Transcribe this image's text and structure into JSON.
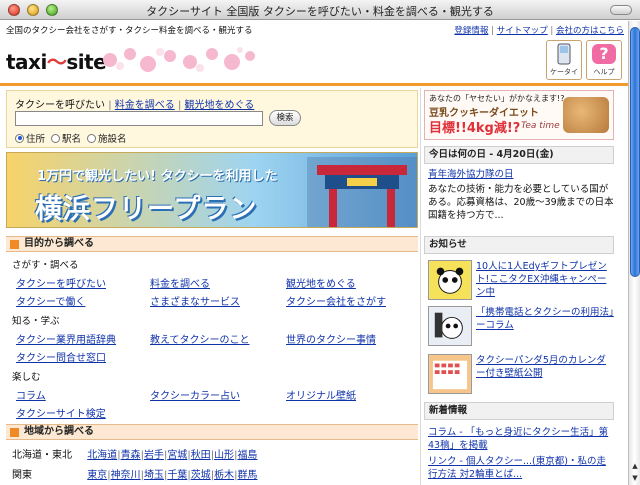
{
  "window": {
    "title": "タクシーサイト 全国版 タクシーを呼びたい・料金を調べる・観光する"
  },
  "topstrip": {
    "tagline": "全国のタクシー会社をさがす・タクシー料金を調べる・観光する",
    "links": [
      "登録情報",
      "サイトマップ",
      "会社の方はこちら"
    ]
  },
  "header": {
    "logo_text": "taxi",
    "logo_wave": "〜",
    "logo_text2": "site",
    "phone_label": "ケータイ",
    "help_label": "ヘルプ",
    "help_glyph": "?"
  },
  "search": {
    "tab_current": "タクシーを呼びたい",
    "tab_fare": "料金を調べる",
    "tab_sightseeing": "観光地をめぐる",
    "input_value": "",
    "button": "検索",
    "radios": [
      "住所",
      "駅名",
      "施設名"
    ],
    "selected": 0
  },
  "banner": {
    "line1": "1万円で観光したい! タクシーを利用した",
    "line2": "横浜フリープラン"
  },
  "purpose": {
    "heading": "目的から調べる",
    "groups": [
      {
        "label": "さがす・調べる",
        "rows": [
          [
            "タクシーを呼びたい",
            "料金を調べる",
            "観光地をめぐる"
          ],
          [
            "タクシーで働く",
            "さまざまなサービス",
            "タクシー会社をさがす"
          ]
        ]
      },
      {
        "label": "知る・学ぶ",
        "rows": [
          [
            "タクシー業界用語辞典",
            "教えてタクシーのこと",
            "世界のタクシー事情"
          ],
          [
            "タクシー問合せ窓口",
            "",
            ""
          ]
        ]
      },
      {
        "label": "楽しむ",
        "rows": [
          [
            "コラム",
            "タクシーカラー占い",
            "オリジナル壁紙"
          ],
          [
            "タクシーサイト検定",
            "",
            ""
          ]
        ]
      }
    ]
  },
  "region": {
    "heading": "地域から調べる",
    "rows": [
      {
        "name": "北海道・東北",
        "prefs": [
          "北海道",
          "青森",
          "岩手",
          "宮城",
          "秋田",
          "山形",
          "福島"
        ]
      },
      {
        "name": "関東",
        "prefs": [
          "東京",
          "神奈川",
          "埼玉",
          "千葉",
          "茨城",
          "栃木",
          "群馬"
        ]
      }
    ]
  },
  "ad": {
    "line1": "あなたの「ヤセたい」がかなえます!?",
    "line2": "豆乳クッキーダイエット",
    "line3": "目標!!4kg減!?",
    "line4": "Tea time"
  },
  "today": {
    "heading": "今日は何の日 - 4月20日(金)",
    "title": "青年海外協力隊の日",
    "body": "あなたの技術・能力を必要としている国がある。応募資格は、20歳〜39歳までの日本国籍を持つ方で..."
  },
  "notices": {
    "heading": "お知らせ",
    "items": [
      "10人に1人Edyギフトプレゼント!ここタクEX沖縄キャンペーン中",
      "「携帯電話とタクシーの利用法」ーコラム",
      "タクシーパンダ5月のカレンダー付き壁紙公開"
    ]
  },
  "news": {
    "heading": "新着情報",
    "items": [
      "コラム - 「もっと身近にタクシー生活」第43稿」を掲載",
      "リンク - 個人タクシー...(東京都)・私の走行方法 対2輪車とば..."
    ]
  },
  "colors": {
    "accent": "#f29a2e",
    "link": "#1133aa",
    "banner": "#9ed4f0"
  }
}
